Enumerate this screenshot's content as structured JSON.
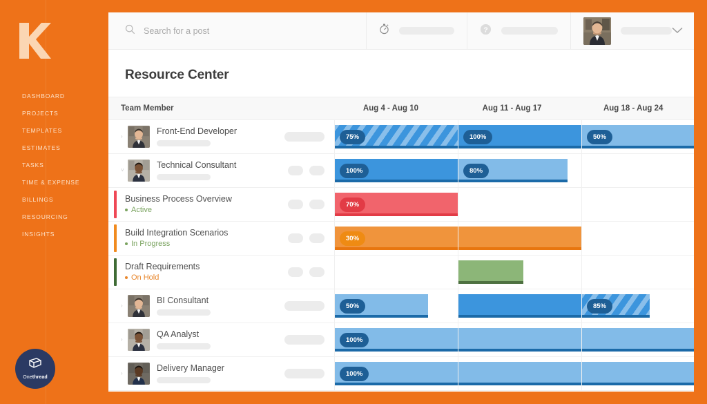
{
  "brand": {
    "logo_icon": "flag-logo-icon",
    "badge_icon": "onethread-cube-icon",
    "badge_text_pre": "One",
    "badge_text_bold": "thread"
  },
  "sidebar": {
    "items": [
      {
        "label": "DASHBOARD",
        "name": "sidebar-item-dashboard"
      },
      {
        "label": "PROJECTS",
        "name": "sidebar-item-projects"
      },
      {
        "label": "TEMPLATES",
        "name": "sidebar-item-templates"
      },
      {
        "label": "ESTIMATES",
        "name": "sidebar-item-estimates"
      },
      {
        "label": "TASKS",
        "name": "sidebar-item-tasks"
      },
      {
        "label": "TIME & EXPENSE",
        "name": "sidebar-item-time-expense"
      },
      {
        "label": "BILLINGS",
        "name": "sidebar-item-billings"
      },
      {
        "label": "RESOURCING",
        "name": "sidebar-item-resourcing"
      },
      {
        "label": "INSIGHTS",
        "name": "sidebar-item-insights"
      }
    ]
  },
  "topbar": {
    "search_placeholder": "Search for a post",
    "search_icon": "search-icon",
    "timer_icon": "stopwatch-icon",
    "help_icon": "help-circle-icon",
    "avatar_icon": "user-avatar",
    "chevron_icon": "chevron-down-icon"
  },
  "page": {
    "title": "Resource Center"
  },
  "table": {
    "columns": {
      "member": "Team Member",
      "weeks": [
        "Aug 4 - Aug 10",
        "Aug 11 - Aug 17",
        "Aug 18 - Aug 24"
      ]
    },
    "rows": [
      {
        "type": "member",
        "name": "Front-End Developer",
        "caret": "›",
        "pills": [
          "wide"
        ],
        "bars": [
          {
            "col": 0,
            "width_pct": 100,
            "label": "75%",
            "style": "blue-dk",
            "hatched": true
          },
          {
            "col": 1,
            "width_pct": 100,
            "label": "100%",
            "style": "blue-dk",
            "hatched": false
          },
          {
            "col": 2,
            "width_pct": 100,
            "label": "50%",
            "style": "blue-lt",
            "hatched": false
          }
        ]
      },
      {
        "type": "member",
        "name": "Technical Consultant",
        "caret": "˅",
        "pills": [
          "sm",
          "sm"
        ],
        "bars": [
          {
            "col": 0,
            "width_pct": 100,
            "label": "100%",
            "style": "blue-dk",
            "hatched": false
          },
          {
            "col": 1,
            "width_pct": 89,
            "label": "80%",
            "style": "blue-lt",
            "hatched": false
          }
        ]
      },
      {
        "type": "task",
        "name": "Business Process Overview",
        "status": "Active",
        "status_color": "#7aa35f",
        "dot_color": "#7aa35f",
        "accent": "#ef4856",
        "pills": [
          "sm",
          "sm"
        ],
        "bars": [
          {
            "col": 0,
            "width_pct": 100,
            "label": "70%",
            "style": "red",
            "hatched": false
          }
        ]
      },
      {
        "type": "task",
        "name": "Build Integration Scenarios",
        "status": "In Progress",
        "status_color": "#7aa35f",
        "dot_color": "#7aa35f",
        "accent": "#f18b1f",
        "pills": [
          "sm",
          "sm"
        ],
        "bars": [
          {
            "col": 0,
            "width_pct": 100,
            "label": "30%",
            "style": "orange",
            "hatched": false
          },
          {
            "col": 1,
            "width_pct": 100,
            "label": "",
            "style": "orange",
            "hatched": false
          }
        ]
      },
      {
        "type": "task",
        "name": "Draft Requirements",
        "status": "On Hold",
        "status_color": "#e8862b",
        "dot_color": "#e8862b",
        "accent": "#3f6b35",
        "pills": [
          "sm",
          "sm"
        ],
        "bars": [
          {
            "col": 1,
            "width_pct": 53,
            "label": "",
            "style": "green",
            "hatched": false
          }
        ]
      },
      {
        "type": "member",
        "name": "BI Consultant",
        "caret": "›",
        "pills": [
          "wide"
        ],
        "bars": [
          {
            "col": 0,
            "width_pct": 76,
            "label": "50%",
            "style": "blue-lt",
            "hatched": false
          },
          {
            "col": 1,
            "width_pct": 100,
            "label": "",
            "style": "blue-dk",
            "hatched": false
          },
          {
            "col": 2,
            "width_pct": 55,
            "label": "85%",
            "style": "blue-dk",
            "hatched": true
          }
        ]
      },
      {
        "type": "member",
        "name": "QA Analyst",
        "caret": "›",
        "pills": [
          "wide"
        ],
        "bars": [
          {
            "col": 0,
            "width_pct": 100,
            "label": "100%",
            "style": "blue-lt",
            "hatched": false
          },
          {
            "col": 1,
            "width_pct": 100,
            "label": "",
            "style": "blue-lt",
            "hatched": false
          },
          {
            "col": 2,
            "width_pct": 100,
            "label": "",
            "style": "blue-lt",
            "hatched": false
          }
        ]
      },
      {
        "type": "member",
        "name": "Delivery Manager",
        "caret": "›",
        "pills": [
          "wide"
        ],
        "bars": [
          {
            "col": 0,
            "width_pct": 100,
            "label": "100%",
            "style": "blue-lt",
            "hatched": false
          },
          {
            "col": 1,
            "width_pct": 100,
            "label": "",
            "style": "blue-lt",
            "hatched": false
          },
          {
            "col": 2,
            "width_pct": 100,
            "label": "",
            "style": "blue-lt",
            "hatched": false
          }
        ]
      }
    ]
  },
  "colors": {
    "brand_orange": "#ee7219",
    "bar_blue_dark": "#3c95dd",
    "bar_blue_light": "#82bbe8",
    "bar_red": "#f1646c",
    "bar_orange": "#f0943c",
    "bar_green": "#8cb678",
    "badge_navy": "#1e5f96"
  }
}
